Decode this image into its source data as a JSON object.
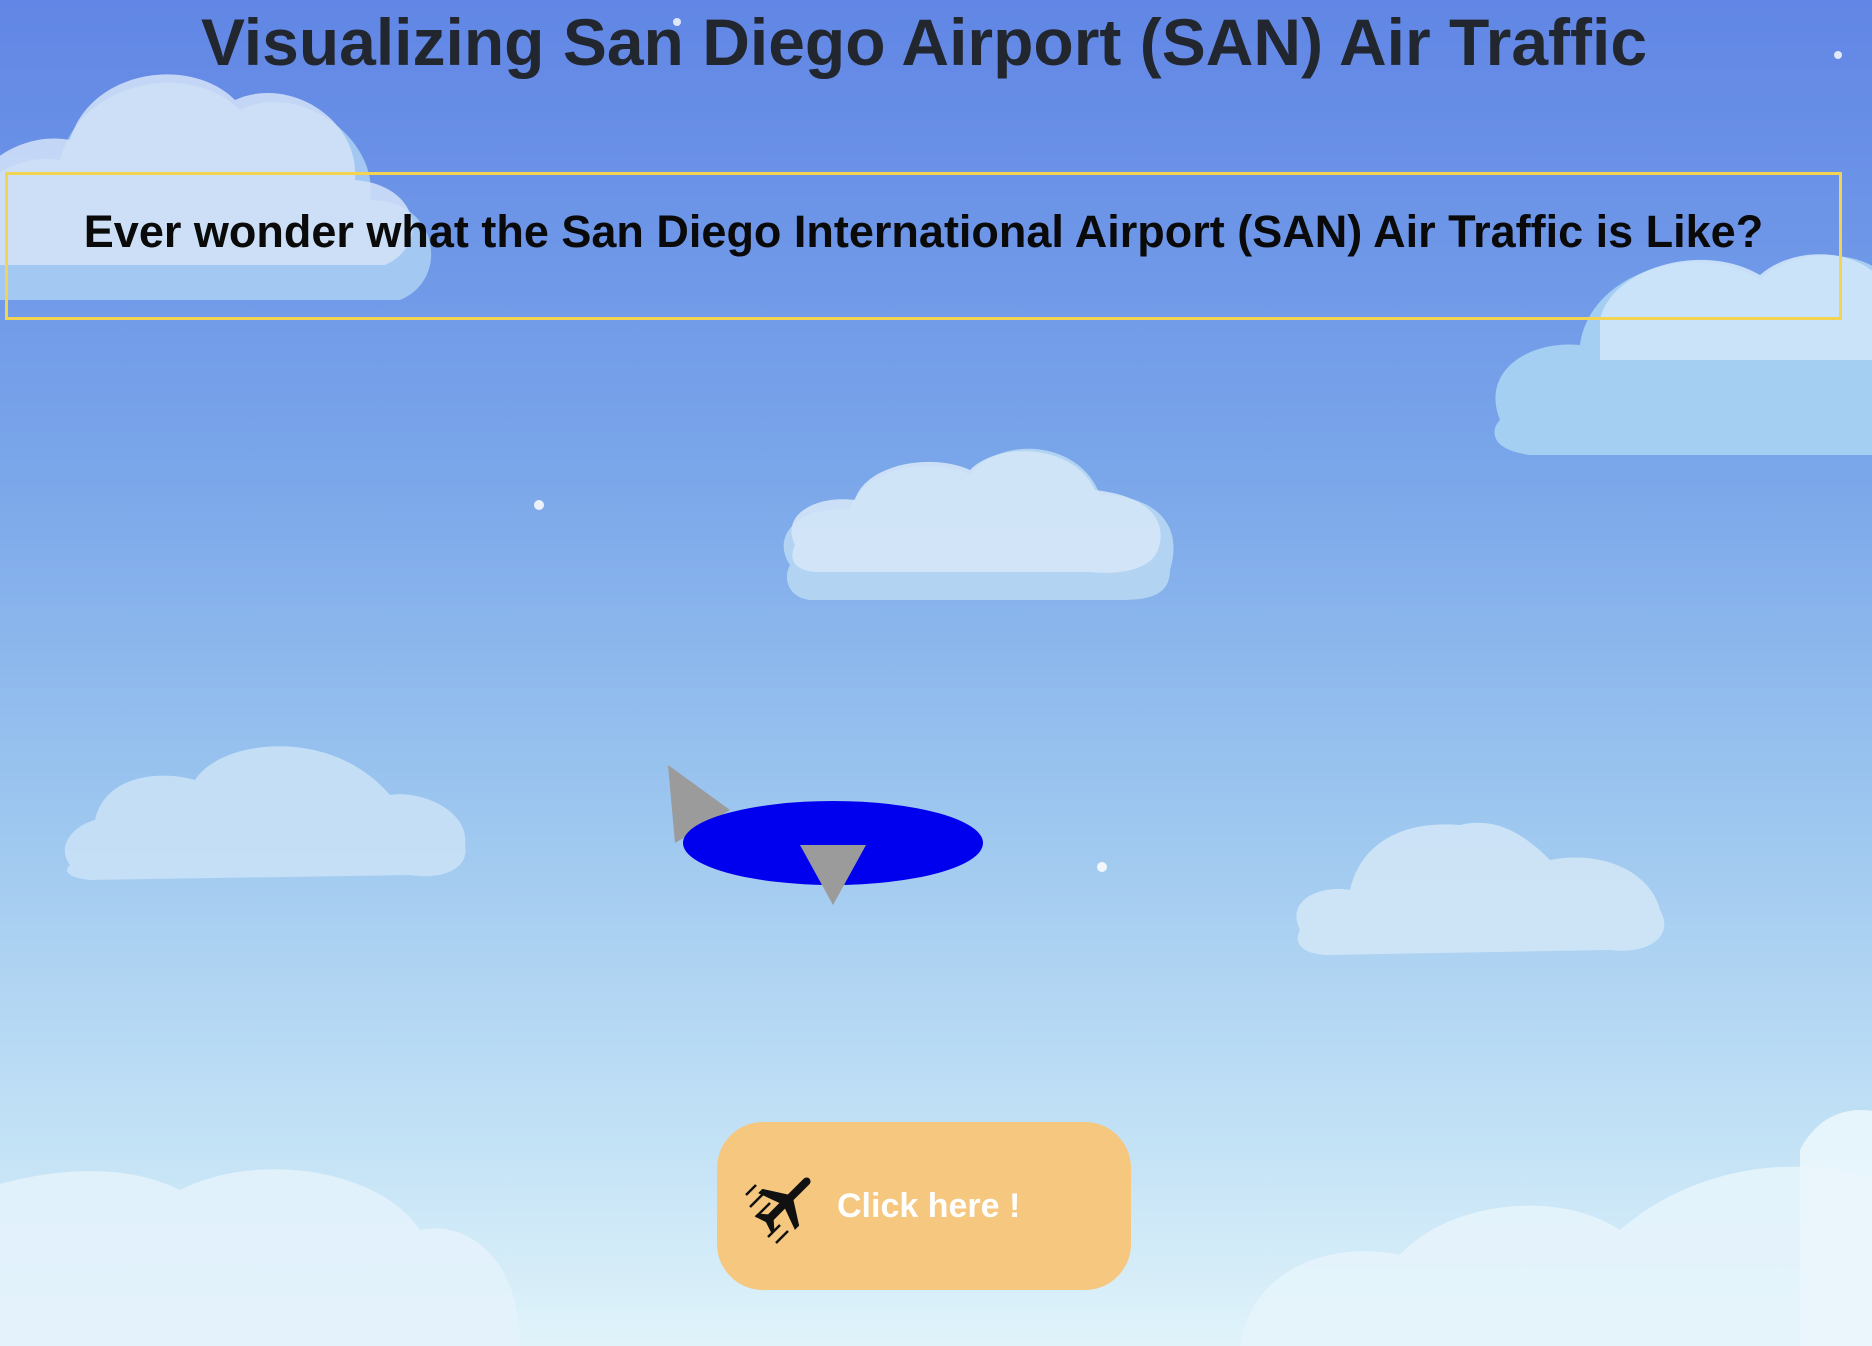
{
  "page": {
    "title": "Visualizing San Diego Airport (SAN) Air Traffic"
  },
  "intro": {
    "question": "Ever wonder what the San Diego International Airport (SAN) Air Traffic is Like?"
  },
  "cta": {
    "label": "Click here !",
    "icon": "airplane-icon"
  },
  "colors": {
    "sky_top": "#6186e5",
    "sky_bottom": "#e0f3fa",
    "question_border": "#f3d352",
    "button_bg": "#f5c77f",
    "plane_body": "#0000ee",
    "plane_fins": "#999999"
  }
}
